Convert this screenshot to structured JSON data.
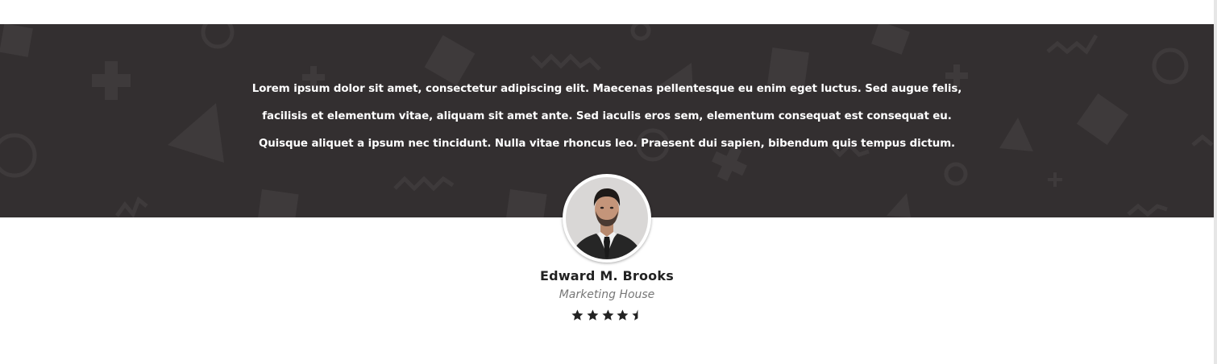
{
  "testimonial": {
    "quote_lines": [
      "Lorem ipsum dolor sit amet, consectetur adipiscing elit. Maecenas pellentesque eu enim eget luctus. Sed augue felis,",
      "facilisis et elementum vitae, aliquam sit amet ante. Sed iaculis eros sem, elementum consequat est consequat eu.",
      "Quisque aliquet a ipsum nec tincidunt. Nulla vitae rhoncus leo. Praesent dui sapien, bibendum quis tempus dictum."
    ],
    "author_name": "Edward M. Brooks",
    "author_company": "Marketing House",
    "rating": 4.5,
    "rating_max": 5
  },
  "colors": {
    "band_background": "#332f30",
    "pattern_shape": "#3d393a",
    "quote_text": "#ffffff",
    "name_text": "#222222",
    "company_text": "#777777",
    "star": "#222222"
  },
  "icons": {
    "star_full": "star-icon",
    "star_half": "star-half-icon"
  }
}
